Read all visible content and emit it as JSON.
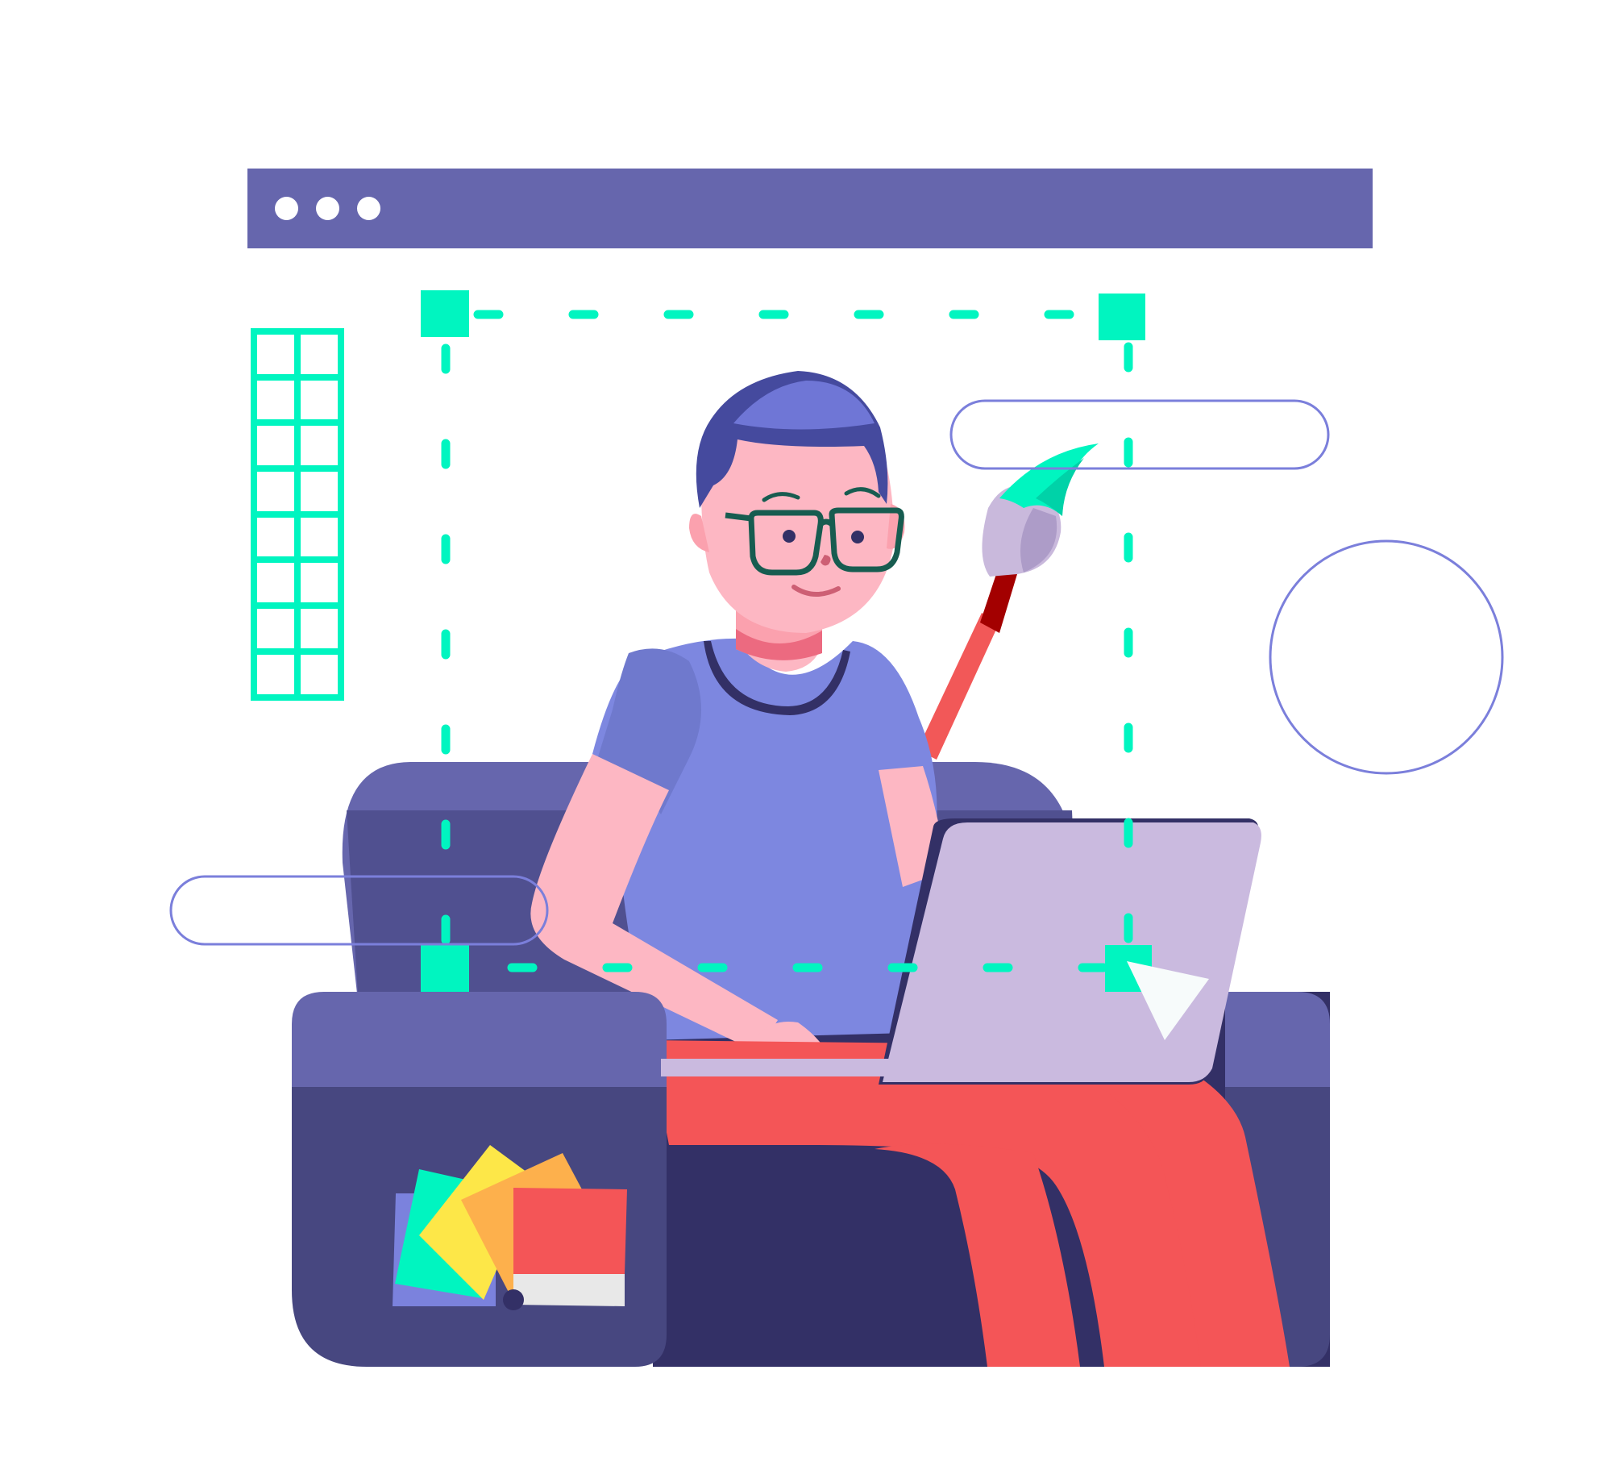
{
  "colors": {
    "background": "#ffffff",
    "window_bar": "#6666ad",
    "guide_green": "#00f5c0",
    "outline_blue": "#7b7fdb",
    "sofa_back": "#6666ad",
    "sofa_shadow": "#505090",
    "sofa_seat_dark": "#333066",
    "sofa_arm_front": "#474780",
    "skin": "#fdb7c3",
    "shirt": "#7d87e0",
    "hair": "#454a9e",
    "pants": "#f45557",
    "laptop": "#cabadf",
    "glasses": "#175c50",
    "brush_handle": "#f25858",
    "brush_ferrule": "#a30000",
    "brush_bristles": "#c9b9dc",
    "swatch_colors": [
      "#7b82dd",
      "#00f5c0",
      "#fde748",
      "#fdb04c",
      "#f45557",
      "#e8e8e8"
    ]
  },
  "window": {
    "dot_count": 3
  },
  "icons": {
    "window_dots": "ellipsis-dots-icon",
    "grid": "grid-layout-icon",
    "paintbrush": "paintbrush-icon",
    "cursor": "cursor-arrow-icon",
    "swatches": "color-swatches-icon",
    "circle": "circle-shape-icon"
  }
}
